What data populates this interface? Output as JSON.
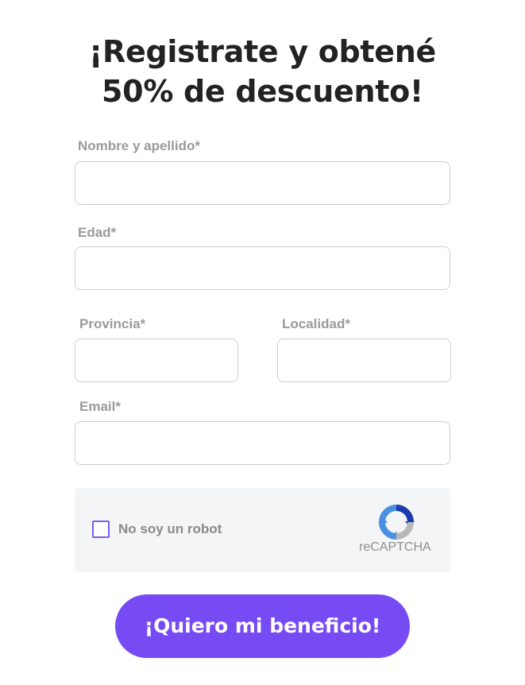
{
  "headline": {
    "line1": "¡Registrate y obtené",
    "line2": "50% de descuento!"
  },
  "form": {
    "name_label": "Nombre y apellido*",
    "age_label": "Edad*",
    "province_label": "Provincia*",
    "locality_label": "Localidad*",
    "email_label": "Email*"
  },
  "captcha": {
    "checkbox_label": "No soy un robot",
    "brand": "reCAPTCHA"
  },
  "submit_label": "¡Quiero mi beneficio!",
  "colors": {
    "accent": "#774bf4",
    "heading": "#222222",
    "label": "#9a9a9a",
    "border": "#cfcfcf",
    "captcha_bg": "#f4f5f7"
  },
  "icons": {
    "captcha_logo": "recaptcha-icon"
  }
}
